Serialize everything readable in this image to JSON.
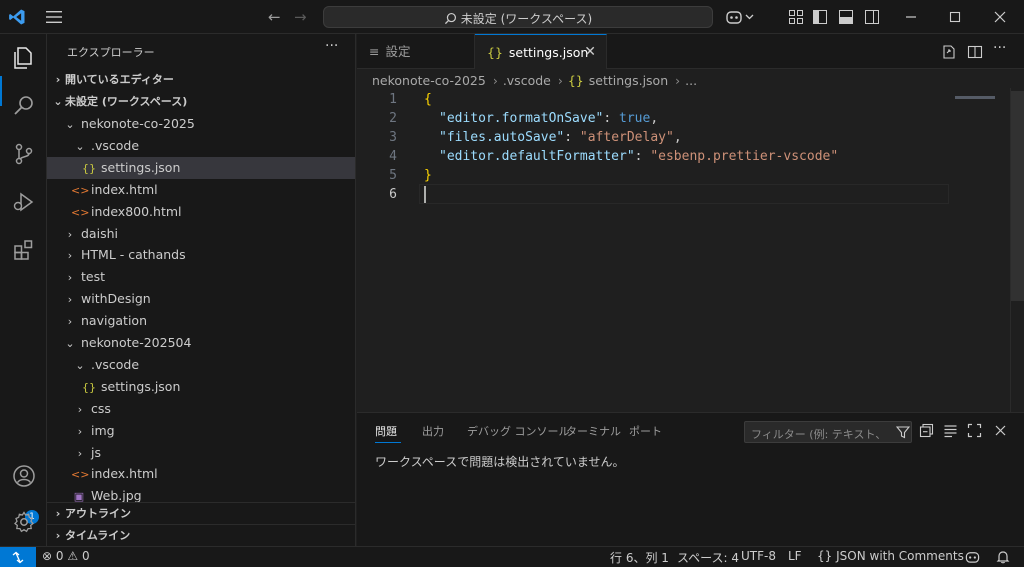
{
  "titlebar": {
    "search_text": "未設定 (ワークスペース)"
  },
  "sidebar": {
    "title": "エクスプローラー",
    "sections": {
      "open_editors": "開いているエディター",
      "workspace": "未設定 (ワークスペース)",
      "outline": "アウトライン",
      "timeline": "タイムライン"
    },
    "tree": [
      {
        "label": "nekonote-co-2025",
        "type": "folder-open"
      },
      {
        "label": ".vscode",
        "type": "folder-open"
      },
      {
        "label": "settings.json",
        "type": "json"
      },
      {
        "label": "index.html",
        "type": "html"
      },
      {
        "label": "index800.html",
        "type": "html"
      },
      {
        "label": "daishi",
        "type": "folder"
      },
      {
        "label": "HTML - cathands",
        "type": "folder"
      },
      {
        "label": "test",
        "type": "folder"
      },
      {
        "label": "withDesign",
        "type": "folder"
      },
      {
        "label": "navigation",
        "type": "folder"
      },
      {
        "label": "nekonote-202504",
        "type": "folder-open"
      },
      {
        "label": ".vscode",
        "type": "folder-open"
      },
      {
        "label": "settings.json",
        "type": "json"
      },
      {
        "label": "css",
        "type": "folder"
      },
      {
        "label": "img",
        "type": "folder"
      },
      {
        "label": "js",
        "type": "folder"
      },
      {
        "label": "index.html",
        "type": "html"
      },
      {
        "label": "Web.jpg",
        "type": "image"
      }
    ],
    "icons": {
      "json": "{}",
      "html": "<>",
      "chevron_right": "›",
      "chevron_down": "⌄"
    }
  },
  "activity": {
    "account_badge": "1"
  },
  "tabs": [
    {
      "label": "設定",
      "icon": "≡"
    },
    {
      "label": "settings.json",
      "icon": "{}"
    }
  ],
  "tab_close_glyph": "✕",
  "breadcrumb": [
    "nekonote-co-2025",
    ".vscode",
    "settings.json",
    "..."
  ],
  "breadcrumb_sep": "›",
  "editor": {
    "line_numbers": [
      "1",
      "2",
      "3",
      "4",
      "5",
      "6"
    ],
    "code": {
      "l1_open": "{",
      "l2_key": "\"editor.formatOnSave\"",
      "l2_colon": ": ",
      "l2_val": "true",
      "l2_comma": ",",
      "l3_key": "\"files.autoSave\"",
      "l3_colon": ": ",
      "l3_val": "\"afterDelay\"",
      "l3_comma": ",",
      "l4_key": "\"editor.defaultFormatter\"",
      "l4_colon": ": ",
      "l4_val": "\"esbenp.prettier-vscode\"",
      "l5_close": "}"
    }
  },
  "panel": {
    "tabs": [
      "問題",
      "出力",
      "デバッグ コンソール",
      "ターミナル",
      "ポート"
    ],
    "filter_placeholder": "フィルター (例: テキスト、**/*.ts、!**/node_modules/**)",
    "message": "ワークスペースで問題は検出されていません。"
  },
  "statusbar": {
    "errors": "0",
    "warnings": "0",
    "position": "行 6、列 1",
    "spaces": "スペース: 4",
    "encoding": "UTF-8",
    "eol": "LF",
    "language": "JSON with Comments",
    "language_icon": "{}"
  },
  "colors": {
    "accent": "#0078d4",
    "background": "#1f1f1f",
    "chrome": "#181818"
  }
}
